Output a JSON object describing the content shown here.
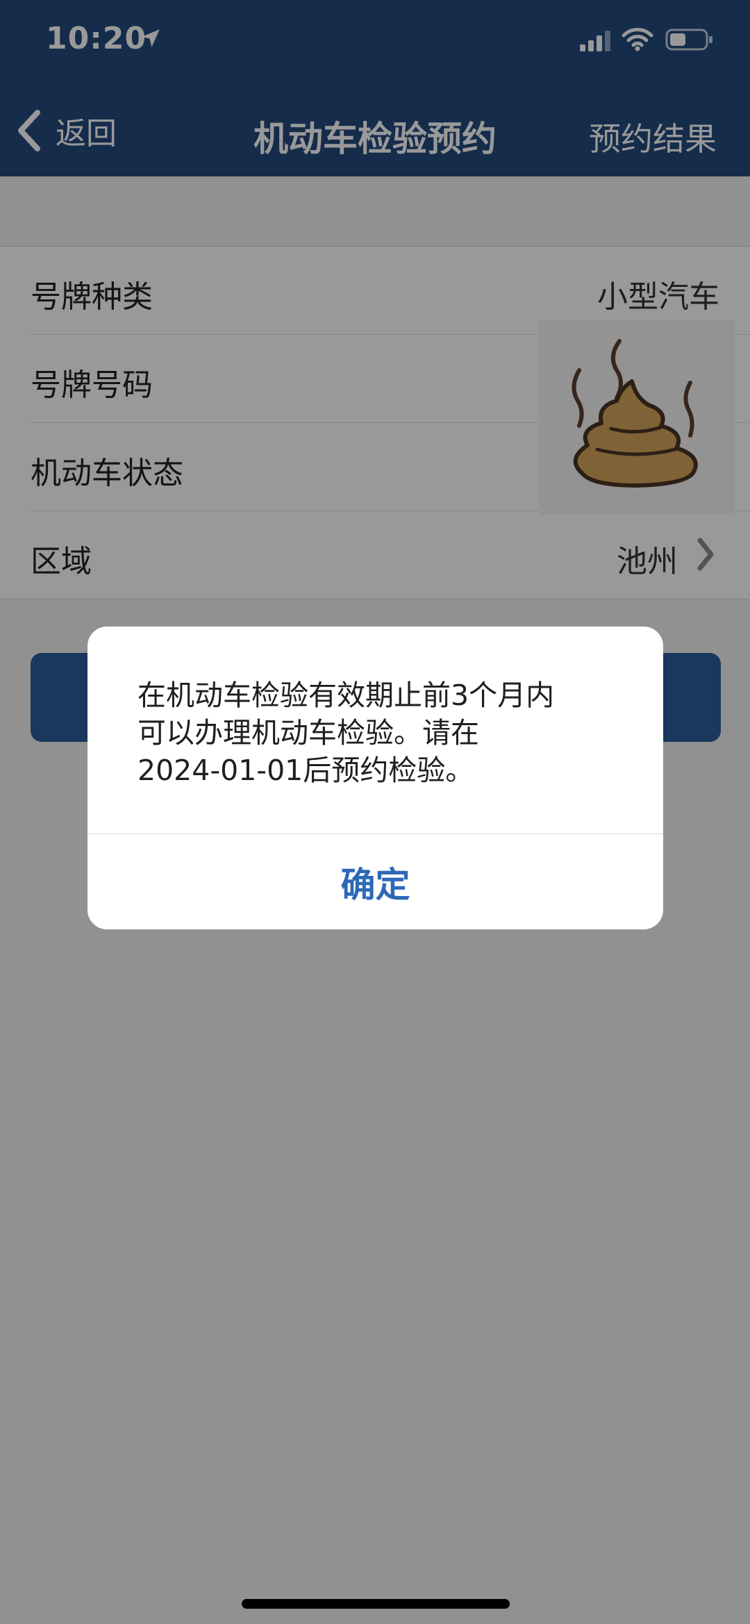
{
  "status_bar": {
    "time": "10:20"
  },
  "nav": {
    "back_label": "返回",
    "title": "机动车检验预约",
    "right_label": "预约结果"
  },
  "form": {
    "rows": [
      {
        "label": "号牌种类",
        "value": "小型汽车"
      },
      {
        "label": "号牌号码",
        "value": ""
      },
      {
        "label": "机动车状态",
        "value": ""
      },
      {
        "label": "区域",
        "value": "池州"
      }
    ]
  },
  "alert": {
    "message_lines": [
      "在机动车检验有效期止前3个月内",
      "可以办理机动车检验。请在",
      "2024-01-01后预约检验。"
    ],
    "ok_label": "确定"
  },
  "colors": {
    "nav_bg": "#234a7e",
    "button_blue": "#2c5e9c",
    "link_blue": "#2d68b8"
  },
  "icons": [
    "location-arrow-icon",
    "signal-icon",
    "wifi-icon",
    "battery-icon",
    "back-chevron-icon",
    "chevron-right-icon",
    "poop-sticker"
  ]
}
